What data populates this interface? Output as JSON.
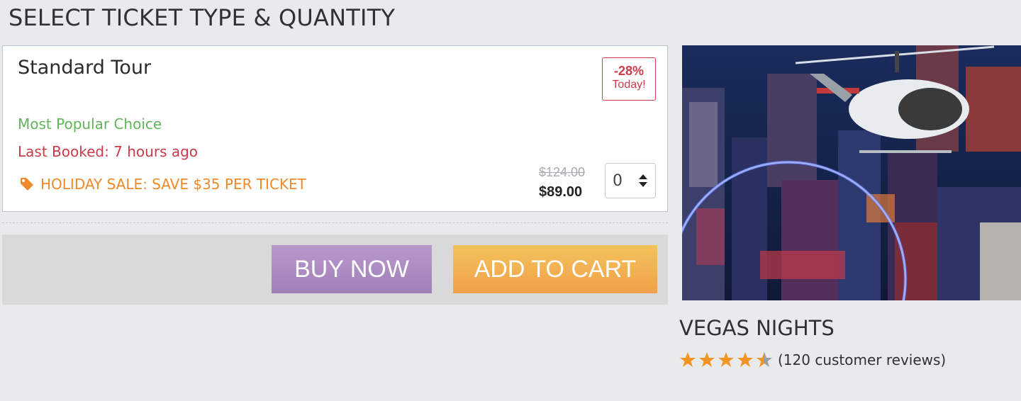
{
  "header": {
    "title": "SELECT TICKET TYPE & QUANTITY"
  },
  "ticket": {
    "name": "Standard Tour",
    "discount_percent": "-28%",
    "discount_label": "Today!",
    "popular_label": "Most Popular Choice",
    "last_booked": "Last Booked: 7 hours ago",
    "sale_text": "HOLIDAY SALE: SAVE $35 PER TICKET",
    "old_price": "$124.00",
    "new_price": "$89.00",
    "quantity": "0"
  },
  "actions": {
    "buy_now": "BUY NOW",
    "add_to_cart": "ADD TO CART"
  },
  "tour": {
    "title": "VEGAS NIGHTS",
    "rating": 4.5,
    "reviews": "(120 customer reviews)"
  },
  "colors": {
    "green": "#63b35c",
    "red": "#c93b4a",
    "orange": "#f0892a",
    "buy_button": "#a98ac0",
    "cart_button": "#f1b252",
    "star": "#f39322"
  },
  "icons": [
    "tag-icon",
    "sort-arrows-icon",
    "star-icon",
    "half-star-icon"
  ]
}
